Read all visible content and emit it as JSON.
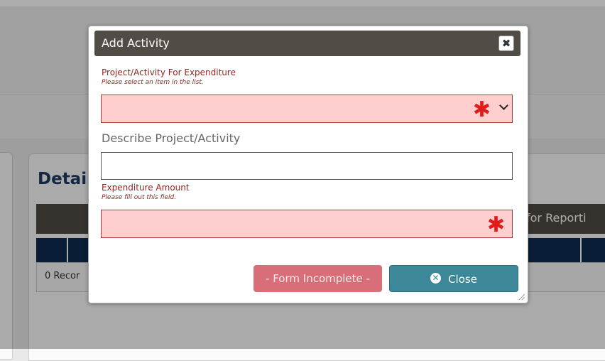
{
  "background": {
    "panel_title": "Detai",
    "darkbar_text": "for Reporti",
    "records_text": "0 Recor"
  },
  "dialog": {
    "title": "Add Activity",
    "close_glyph": "✖",
    "fields": {
      "project": {
        "label": "Project/Activity For Expenditure",
        "error": "Please select an item in the list.",
        "value": ""
      },
      "describe": {
        "label": "Describe Project/Activity",
        "value": ""
      },
      "amount": {
        "label": "Expenditure Amount",
        "error": "Please fill out this field.",
        "value": ""
      }
    },
    "required_marker": "✱",
    "buttons": {
      "incomplete": "- Form Incomplete -",
      "close": "Close",
      "close_icon_glyph": "✕"
    }
  },
  "colors": {
    "titlebar": "#524c47",
    "invalid_field": "#ffcfcf",
    "error_text": "#a01f1f",
    "incomplete_button": "#d86f78",
    "close_button": "#3d8898"
  }
}
